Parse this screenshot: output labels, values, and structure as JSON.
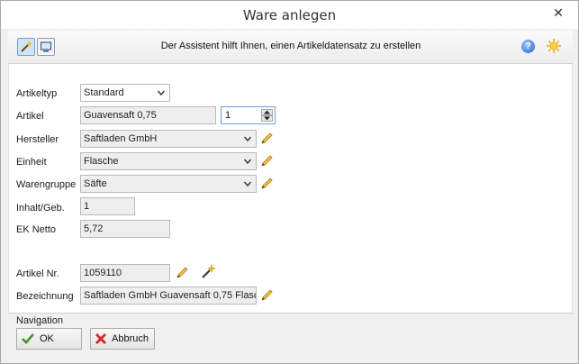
{
  "window": {
    "title": "Ware anlegen",
    "close_glyph": "✕"
  },
  "toolbar": {
    "assistant_text": "Der Assistent hilft Ihnen, einen Artikeldatensatz zu erstellen",
    "wizard_icon": "wand-icon",
    "view_icon": "monitor-icon",
    "help_icon": "help-icon",
    "settings_icon": "sun-icon",
    "help_glyph": "?"
  },
  "form": {
    "artikeltyp": {
      "label": "Artikeltyp",
      "value": "Standard"
    },
    "artikel": {
      "label": "Artikel",
      "value": "Guavensaft 0,75",
      "spinner": "1"
    },
    "hersteller": {
      "label": "Hersteller",
      "value": "Saftladen GmbH"
    },
    "einheit": {
      "label": "Einheit",
      "value": "Flasche"
    },
    "warengruppe": {
      "label": "Warengruppe",
      "value": "Säfte"
    },
    "inhalt": {
      "label": "Inhalt/Geb.",
      "value": "1"
    },
    "ek_netto": {
      "label": "EK Netto",
      "value": "5,72"
    },
    "artikel_nr": {
      "label": "Artikel Nr.",
      "value": "1059110"
    },
    "bezeichnung": {
      "label": "Bezeichnung",
      "value": "Saftladen GmbH Guavensaft 0,75 Flasc"
    }
  },
  "navigation": {
    "label": "Navigation",
    "ok_label": "OK",
    "cancel_label": "Abbruch"
  },
  "colors": {
    "accent_border": "#6aa0dc",
    "ok_check": "#3a9a2a",
    "cancel_x": "#d12b2b"
  }
}
